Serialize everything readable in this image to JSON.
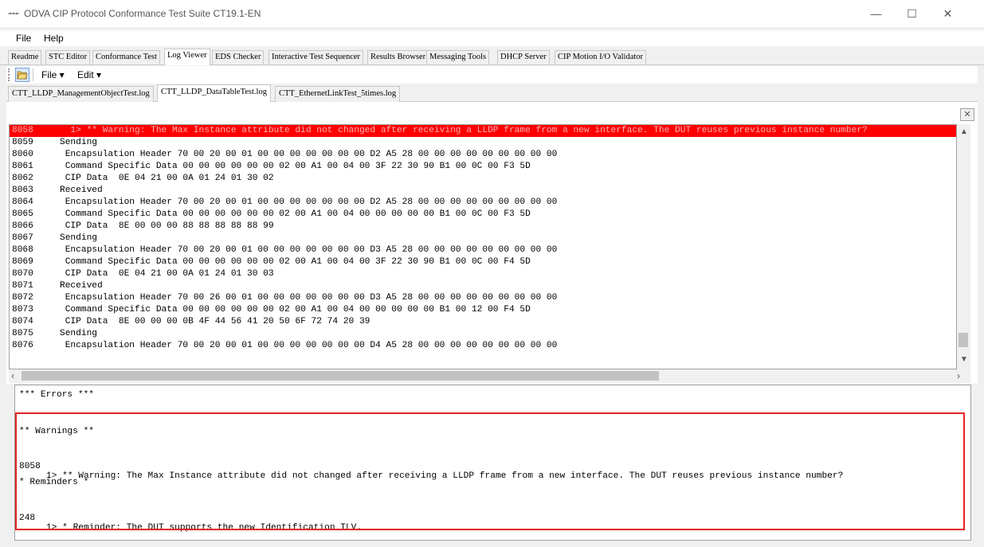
{
  "window": {
    "title": "ODVA CIP Protocol Conformance Test Suite CT19.1-EN",
    "controls": [
      "—",
      "☐",
      "✕"
    ]
  },
  "menu": [
    "File",
    "Help"
  ],
  "tabs": [
    "Readme",
    "STC Editor",
    "Conformance Test",
    "Log Viewer",
    "EDS Checker",
    "Interactive Test Sequencer",
    "Results Browser",
    "Messaging Tools",
    "DHCP Server",
    "CIP Motion I/O Validator"
  ],
  "active_tab": "Log Viewer",
  "toolbar": {
    "file_menu": "File ▾",
    "edit_menu": "Edit ▾"
  },
  "file_tabs": [
    "CTT_LLDP_ManagementObjectTest.log",
    "CTT_LLDP_DataTableTest.log",
    "CTT_EthernetLinkTest_5times.log"
  ],
  "active_file": "CTT_LLDP_DataTableTest.log",
  "log_lines": [
    {
      "n": "8058",
      "t": "  1> ** Warning: The Max Instance attribute did not changed after receiving a LLDP frame from a new interface. The DUT reuses previous instance number?"
    },
    {
      "n": "8059",
      "t": "Sending"
    },
    {
      "n": "8060",
      "t": " Encapsulation Header 70 00 20 00 01 00 00 00 00 00 00 00 D2 A5 28 00 00 00 00 00 00 00 00 00"
    },
    {
      "n": "8061",
      "t": " Command Specific Data 00 00 00 00 00 00 02 00 A1 00 04 00 3F 22 30 90 B1 00 0C 00 F3 5D"
    },
    {
      "n": "8062",
      "t": " CIP Data  0E 04 21 00 0A 01 24 01 30 02"
    },
    {
      "n": "8063",
      "t": "Received"
    },
    {
      "n": "8064",
      "t": " Encapsulation Header 70 00 20 00 01 00 00 00 00 00 00 00 D2 A5 28 00 00 00 00 00 00 00 00 00"
    },
    {
      "n": "8065",
      "t": " Command Specific Data 00 00 00 00 00 00 02 00 A1 00 04 00 00 00 00 00 B1 00 0C 00 F3 5D"
    },
    {
      "n": "8066",
      "t": " CIP Data  8E 00 00 00 88 88 88 88 88 99"
    },
    {
      "n": "8067",
      "t": "Sending"
    },
    {
      "n": "8068",
      "t": " Encapsulation Header 70 00 20 00 01 00 00 00 00 00 00 00 D3 A5 28 00 00 00 00 00 00 00 00 00"
    },
    {
      "n": "8069",
      "t": " Command Specific Data 00 00 00 00 00 00 02 00 A1 00 04 00 3F 22 30 90 B1 00 0C 00 F4 5D"
    },
    {
      "n": "8070",
      "t": " CIP Data  0E 04 21 00 0A 01 24 01 30 03"
    },
    {
      "n": "8071",
      "t": "Received"
    },
    {
      "n": "8072",
      "t": " Encapsulation Header 70 00 26 00 01 00 00 00 00 00 00 00 D3 A5 28 00 00 00 00 00 00 00 00 00"
    },
    {
      "n": "8073",
      "t": " Command Specific Data 00 00 00 00 00 00 02 00 A1 00 04 00 00 00 00 00 B1 00 12 00 F4 5D"
    },
    {
      "n": "8074",
      "t": " CIP Data  8E 00 00 00 0B 4F 44 56 41 20 50 6F 72 74 20 39"
    },
    {
      "n": "8075",
      "t": "Sending"
    },
    {
      "n": "8076",
      "t": " Encapsulation Header 70 00 20 00 01 00 00 00 00 00 00 00 D4 A5 28 00 00 00 00 00 00 00 00 00"
    }
  ],
  "highlighted_line": "8058",
  "errors_panel": {
    "errors_heading": "*** Errors ***",
    "warnings_heading": "** Warnings **",
    "warning_line": {
      "n": "8058",
      "t": "1> ** Warning: The Max Instance attribute did not changed after receiving a LLDP frame from a new interface. The DUT reuses previous instance number?"
    },
    "reminders_heading": "* Reminders *",
    "reminder_line": {
      "n": "248",
      "t": "1> * Reminder: The DUT supports the new Identification TLV."
    }
  },
  "colors": {
    "highlight": "#ff0000",
    "annotation_box": "#e52222"
  }
}
